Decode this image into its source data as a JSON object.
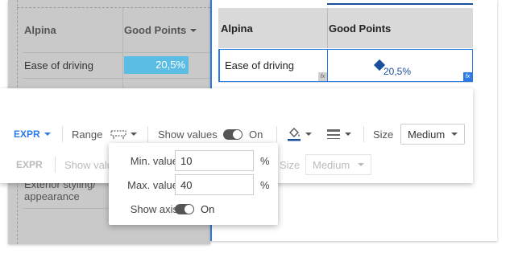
{
  "left_table": {
    "header": {
      "col1": "Alpina",
      "col2": "Good Points"
    },
    "rows": [
      {
        "label": "Ease of driving",
        "value": "20,5%",
        "fill": 0.205
      },
      {
        "label": "Exterior styling/ appearance"
      }
    ]
  },
  "right_table": {
    "header": {
      "col1": "Alpina",
      "col2": "Good Points"
    },
    "rows": [
      {
        "label": "Ease of driving",
        "value": "20,5%"
      }
    ],
    "fx_badge": "fx"
  },
  "toolbar": {
    "expr_label": "EXPR",
    "range_label": "Range",
    "range_icon": "range-bar-icon",
    "show_values_label": "Show values",
    "show_values_state": "On",
    "fill_icon": "paint-bucket-icon",
    "line_icon": "line-style-icon",
    "size_label": "Size",
    "size_value": "Medium",
    "row2": {
      "expr_label": "EXPR",
      "show_values_label": "Show valu",
      "size_label": "Size",
      "size_value": "Medium"
    }
  },
  "range_popover": {
    "min_label": "Min. value",
    "min_value": "10",
    "min_unit": "%",
    "max_label": "Max. value",
    "max_value": "40",
    "max_unit": "%",
    "show_axis_label": "Show axis",
    "show_axis_state": "On"
  },
  "colors": {
    "accent": "#2c7be5",
    "bar": "#5bbde4",
    "marker": "#1a4f9e"
  }
}
